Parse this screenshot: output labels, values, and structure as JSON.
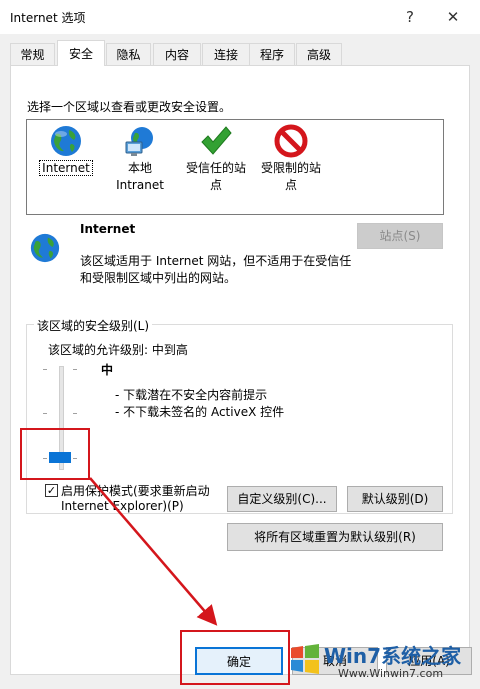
{
  "window": {
    "title": "Internet 选项",
    "help_label": "?",
    "close_label": "✕"
  },
  "tabs": [
    {
      "label": "常规"
    },
    {
      "label": "安全"
    },
    {
      "label": "隐私"
    },
    {
      "label": "内容"
    },
    {
      "label": "连接"
    },
    {
      "label": "程序"
    },
    {
      "label": "高级"
    }
  ],
  "security": {
    "zone_prompt": "选择一个区域以查看或更改安全设置。",
    "zones": [
      {
        "label_1": "Internet",
        "label_2": "",
        "icon": "globe-icon"
      },
      {
        "label_1": "本地",
        "label_2": "Intranet",
        "icon": "local-intranet-icon"
      },
      {
        "label_1": "受信任的站",
        "label_2": "点",
        "icon": "checkmark-icon"
      },
      {
        "label_1": "受限制的站",
        "label_2": "点",
        "icon": "restricted-icon"
      }
    ],
    "zone_title": "Internet",
    "zone_description_1": "该区域适用于 Internet 网站，但不适用于在受信任",
    "zone_description_2": "和受限制区域中列出的网站。",
    "sites_button": "站点(S)",
    "group_title": "该区域的安全级别(L)",
    "allowed_levels": "该区域的允许级别: 中到高",
    "level_name": "中",
    "level_points": [
      "- 下载潜在不安全内容前提示",
      "- 不下载未签名的 ActiveX 控件"
    ],
    "protected_mode_line1": "启用保护模式(要求重新启动",
    "protected_mode_line2": "Internet Explorer)(P)",
    "protected_mode_checked": true,
    "custom_level_button": "自定义级别(C)...",
    "default_level_button": "默认级别(D)",
    "reset_all_button": "将所有区域重置为默认级别(R)"
  },
  "footer": {
    "ok_button": "确定",
    "cancel_button": "取消",
    "apply_button": "应用(A)"
  },
  "watermark": {
    "brand": "Win7系统之家",
    "url": "Www.Winwin7.com"
  },
  "colors": {
    "accent": "#0a74d6",
    "annotation": "#d4161c"
  }
}
